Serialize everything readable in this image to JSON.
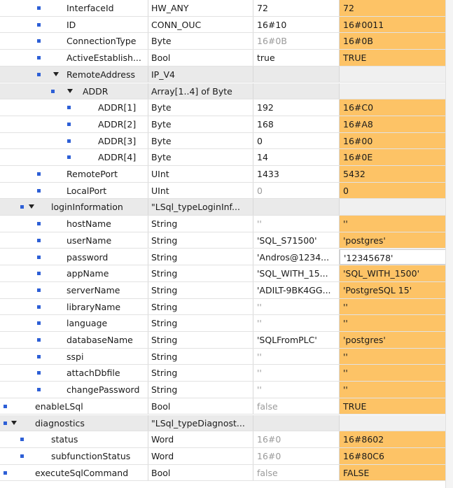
{
  "rows": [
    {
      "name": "InterfaceId",
      "type": "HW_ANY",
      "start": "72",
      "start_gray": false,
      "monitor": "72",
      "mon_bg": "orange",
      "indent": 2,
      "caret": false,
      "shaded": false
    },
    {
      "name": "ID",
      "type": "CONN_OUC",
      "start": "16#10",
      "start_gray": false,
      "monitor": "16#0011",
      "mon_bg": "orange",
      "indent": 2,
      "caret": false,
      "shaded": false
    },
    {
      "name": "ConnectionType",
      "type": "Byte",
      "start": "16#0B",
      "start_gray": true,
      "monitor": "16#0B",
      "mon_bg": "orange",
      "indent": 2,
      "caret": false,
      "shaded": false
    },
    {
      "name": "ActiveEstablish...",
      "type": "Bool",
      "start": "true",
      "start_gray": false,
      "monitor": "TRUE",
      "mon_bg": "orange",
      "indent": 2,
      "caret": false,
      "shaded": false
    },
    {
      "name": "RemoteAddress",
      "type": "IP_V4",
      "start": "",
      "start_gray": false,
      "monitor": "",
      "mon_bg": "grey",
      "indent": 2,
      "caret": true,
      "shaded": true
    },
    {
      "name": "ADDR",
      "type": "Array[1..4] of Byte",
      "start": "",
      "start_gray": false,
      "monitor": "",
      "mon_bg": "grey",
      "indent": 3,
      "caret": true,
      "shaded": true
    },
    {
      "name": "ADDR[1]",
      "type": "Byte",
      "start": "192",
      "start_gray": false,
      "monitor": "16#C0",
      "mon_bg": "orange",
      "indent": 4,
      "caret": false,
      "shaded": false
    },
    {
      "name": "ADDR[2]",
      "type": "Byte",
      "start": "168",
      "start_gray": false,
      "monitor": "16#A8",
      "mon_bg": "orange",
      "indent": 4,
      "caret": false,
      "shaded": false
    },
    {
      "name": "ADDR[3]",
      "type": "Byte",
      "start": "0",
      "start_gray": false,
      "monitor": "16#00",
      "mon_bg": "orange",
      "indent": 4,
      "caret": false,
      "shaded": false
    },
    {
      "name": "ADDR[4]",
      "type": "Byte",
      "start": "14",
      "start_gray": false,
      "monitor": "16#0E",
      "mon_bg": "orange",
      "indent": 4,
      "caret": false,
      "shaded": false
    },
    {
      "name": "RemotePort",
      "type": "UInt",
      "start": "1433",
      "start_gray": false,
      "monitor": "5432",
      "mon_bg": "orange",
      "indent": 2,
      "caret": false,
      "shaded": false
    },
    {
      "name": "LocalPort",
      "type": "UInt",
      "start": "0",
      "start_gray": true,
      "monitor": "0",
      "mon_bg": "orange",
      "indent": 2,
      "caret": false,
      "shaded": false
    },
    {
      "name": "loginInformation",
      "type": "\"LSql_typeLoginInf...",
      "start": "",
      "start_gray": false,
      "monitor": "",
      "mon_bg": "grey",
      "indent": 1,
      "caret": true,
      "shaded": true
    },
    {
      "name": "hostName",
      "type": "String",
      "start": "''",
      "start_gray": true,
      "monitor": "''",
      "mon_bg": "orange",
      "indent": 2,
      "caret": false,
      "shaded": false
    },
    {
      "name": "userName",
      "type": "String",
      "start": "'SQL_S71500'",
      "start_gray": false,
      "monitor": "'postgres'",
      "mon_bg": "orange",
      "indent": 2,
      "caret": false,
      "shaded": false
    },
    {
      "name": "password",
      "type": "String",
      "start": "'Andros@1234...",
      "start_gray": false,
      "monitor": "'12345678'",
      "mon_bg": "white",
      "indent": 2,
      "caret": false,
      "shaded": false
    },
    {
      "name": "appName",
      "type": "String",
      "start": "'SQL_WITH_15...",
      "start_gray": false,
      "monitor": "'SQL_WITH_1500'",
      "mon_bg": "orange",
      "indent": 2,
      "caret": false,
      "shaded": false
    },
    {
      "name": "serverName",
      "type": "String",
      "start": "'ADILT-9BK4GG...",
      "start_gray": false,
      "monitor": "'PostgreSQL 15'",
      "mon_bg": "orange",
      "indent": 2,
      "caret": false,
      "shaded": false
    },
    {
      "name": "libraryName",
      "type": "String",
      "start": "''",
      "start_gray": true,
      "monitor": "''",
      "mon_bg": "orange",
      "indent": 2,
      "caret": false,
      "shaded": false
    },
    {
      "name": "language",
      "type": "String",
      "start": "''",
      "start_gray": true,
      "monitor": "''",
      "mon_bg": "orange",
      "indent": 2,
      "caret": false,
      "shaded": false
    },
    {
      "name": "databaseName",
      "type": "String",
      "start": "'SQLFromPLC'",
      "start_gray": false,
      "monitor": "'postgres'",
      "mon_bg": "orange",
      "indent": 2,
      "caret": false,
      "shaded": false
    },
    {
      "name": "sspi",
      "type": "String",
      "start": "''",
      "start_gray": true,
      "monitor": "''",
      "mon_bg": "orange",
      "indent": 2,
      "caret": false,
      "shaded": false
    },
    {
      "name": "attachDbfile",
      "type": "String",
      "start": "''",
      "start_gray": true,
      "monitor": "''",
      "mon_bg": "orange",
      "indent": 2,
      "caret": false,
      "shaded": false
    },
    {
      "name": "changePassword",
      "type": "String",
      "start": "''",
      "start_gray": true,
      "monitor": "''",
      "mon_bg": "orange",
      "indent": 2,
      "caret": false,
      "shaded": false
    },
    {
      "name": "enableLSql",
      "type": "Bool",
      "start": "false",
      "start_gray": true,
      "monitor": "TRUE",
      "mon_bg": "orange",
      "indent": 0,
      "caret": false,
      "shaded": false
    },
    {
      "name": "diagnostics",
      "type": "\"LSql_typeDiagnost...",
      "start": "",
      "start_gray": false,
      "monitor": "",
      "mon_bg": "grey",
      "indent": 0,
      "caret": true,
      "shaded": true
    },
    {
      "name": "status",
      "type": "Word",
      "start": "16#0",
      "start_gray": true,
      "monitor": "16#8602",
      "mon_bg": "orange",
      "indent": 1,
      "caret": false,
      "shaded": false
    },
    {
      "name": "subfunctionStatus",
      "type": "Word",
      "start": "16#0",
      "start_gray": true,
      "monitor": "16#80C6",
      "mon_bg": "orange",
      "indent": 1,
      "caret": false,
      "shaded": false
    },
    {
      "name": "executeSqlCommand",
      "type": "Bool",
      "start": "false",
      "start_gray": true,
      "monitor": "FALSE",
      "mon_bg": "orange",
      "indent": 0,
      "caret": false,
      "shaded": false
    }
  ],
  "colors": {
    "monitor_highlight": "#fdc366",
    "bullet": "#2d5fd6",
    "shaded_row": "#eaeaea"
  }
}
